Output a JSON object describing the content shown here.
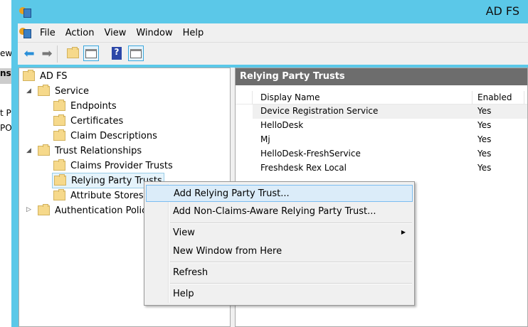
{
  "background_window": {
    "fragments": [
      "ew",
      "ns",
      "t P",
      "PO"
    ]
  },
  "window": {
    "title": "AD FS"
  },
  "menubar": [
    "File",
    "Action",
    "View",
    "Window",
    "Help"
  ],
  "toolbar": {
    "back": "back-icon",
    "forward": "forward-icon",
    "up": "up-folder-icon",
    "show_hide_tree": "console-tree-icon",
    "help": "help-icon",
    "show_hide_action": "action-pane-icon"
  },
  "tree": {
    "root": "AD FS",
    "service": "Service",
    "service_children": [
      "Endpoints",
      "Certificates",
      "Claim Descriptions"
    ],
    "trust": "Trust Relationships",
    "trust_children": [
      "Claims Provider Trusts",
      "Relying Party Trusts",
      "Attribute Stores"
    ],
    "auth": "Authentication Polic"
  },
  "panel": {
    "title": "Relying Party Trusts",
    "columns": [
      "Display Name",
      "Enabled"
    ],
    "rows": [
      {
        "name": "Device Registration Service",
        "enabled": "Yes"
      },
      {
        "name": "HelloDesk",
        "enabled": "Yes"
      },
      {
        "name": "Mj",
        "enabled": "Yes"
      },
      {
        "name": "HelloDesk-FreshService",
        "enabled": "Yes"
      },
      {
        "name": "Freshdesk Rex Local",
        "enabled": "Yes"
      }
    ]
  },
  "context_menu": [
    "Add Relying Party Trust...",
    "Add Non-Claims-Aware Relying Party Trust...",
    "View",
    "New Window from Here",
    "Refresh",
    "Help"
  ]
}
